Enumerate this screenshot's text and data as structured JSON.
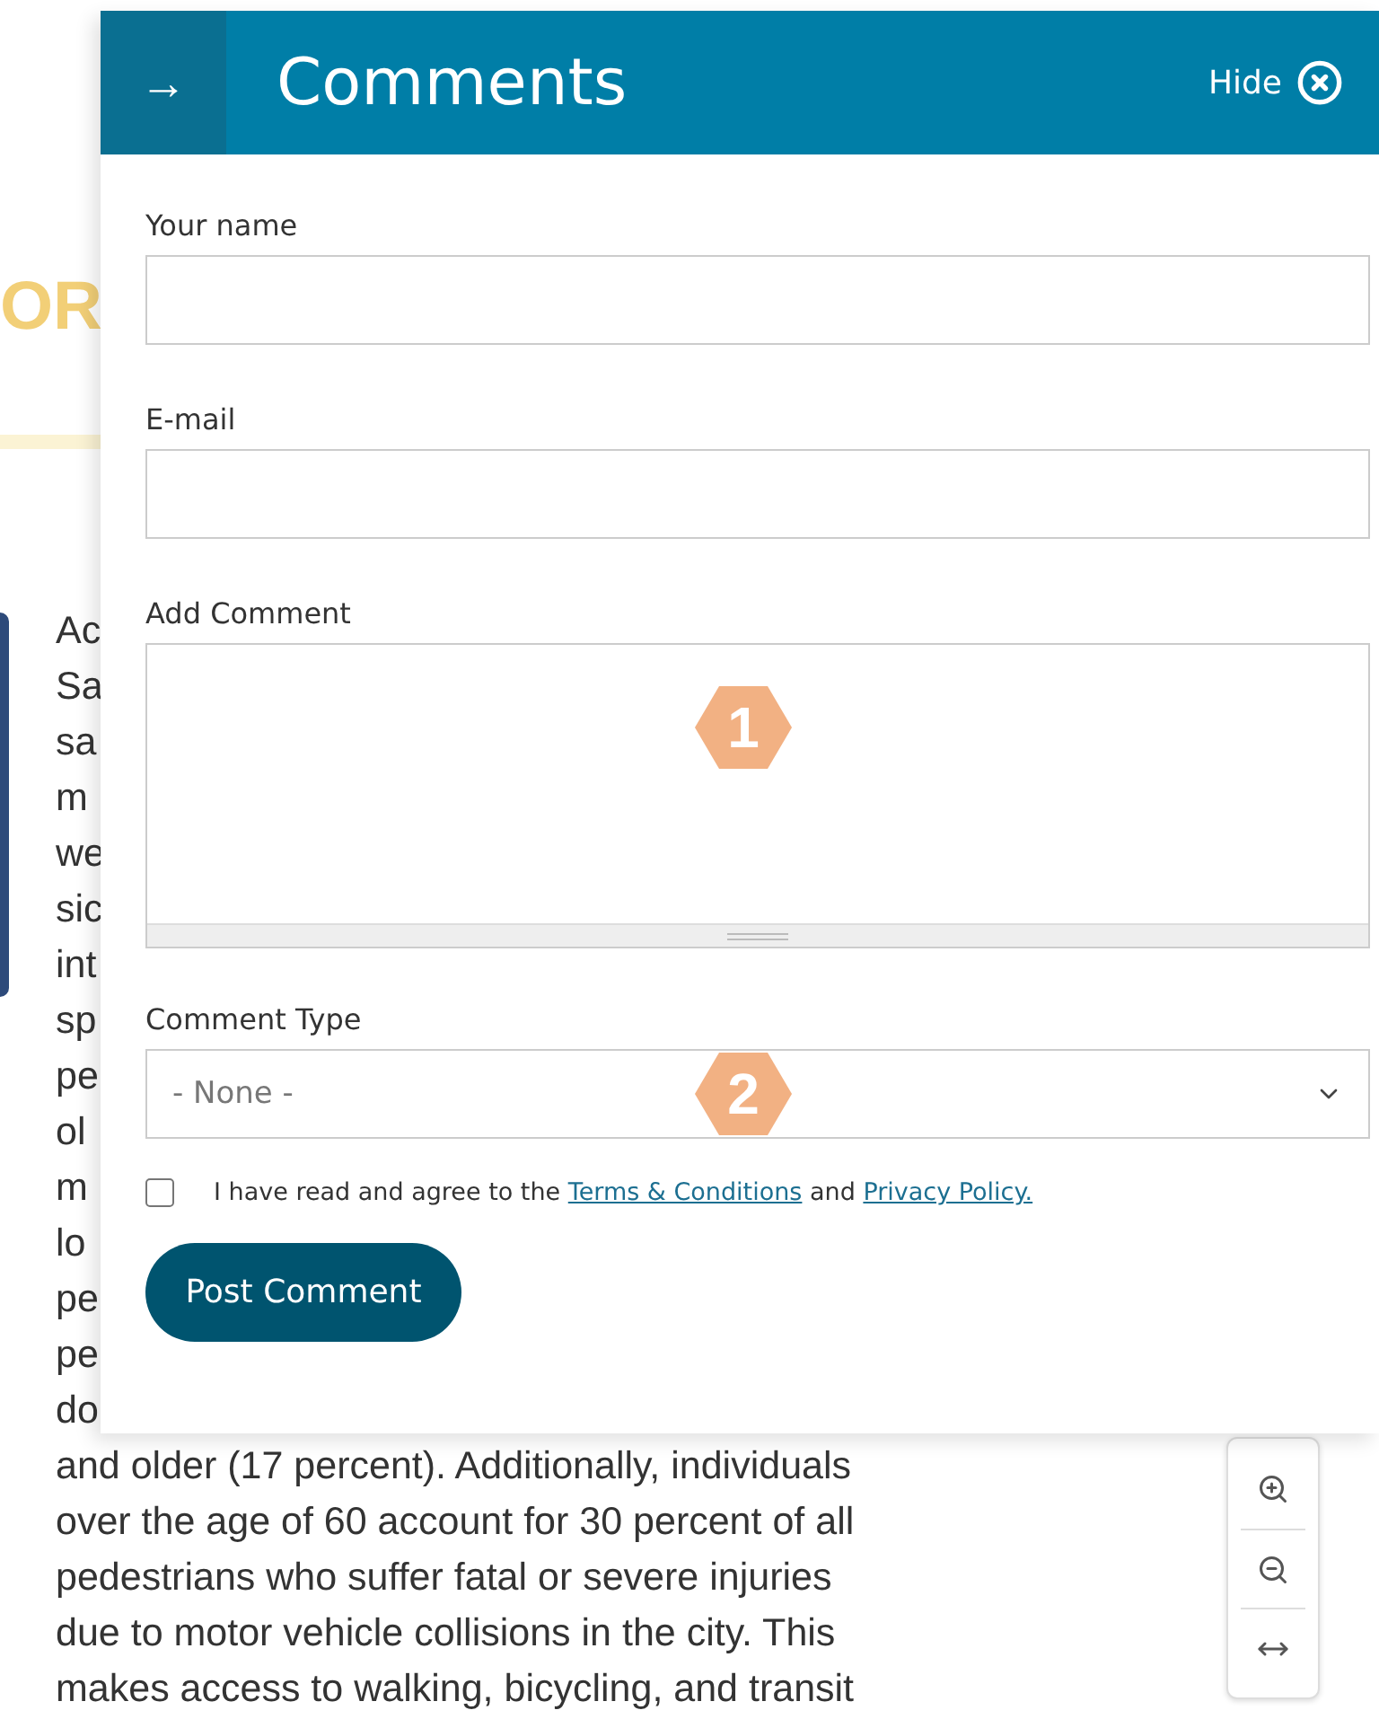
{
  "article": {
    "heading": "OR",
    "lines": [
      "Ac",
      "Sa",
      "sa",
      "m",
      "we",
      "sic",
      "int",
      "sp",
      "pe",
      "ol",
      "m",
      "lo",
      "pe",
      "pe",
      "do",
      "and older (17 percent). Additionally, individuals",
      "over the age of 60 account for 30 percent of all",
      "pedestrians who suffer fatal or severe injuries",
      "due to motor vehicle collisions in the city. This",
      "makes access to walking, bicycling, and transit"
    ]
  },
  "map_controls": [
    {
      "kind": "zoom_in"
    },
    {
      "kind": "zoom_out"
    },
    {
      "kind": "fit_width"
    }
  ],
  "panel": {
    "arrow": "→",
    "title": "Comments",
    "hide": "Hide",
    "fields": [
      {
        "kind": "text",
        "label": "Your name"
      },
      {
        "kind": "text",
        "label": "E-mail"
      },
      {
        "kind": "textarea",
        "label": "Add Comment",
        "badge": "1"
      },
      {
        "kind": "select",
        "label": "Comment Type",
        "value": "- None -",
        "badge": "2"
      }
    ],
    "agree": {
      "checked": false,
      "text": "I have read and agree to the",
      "terms": "Terms & Conditions",
      "and": "and",
      "privacy": "Privacy Policy."
    },
    "submit": "Post Comment"
  }
}
